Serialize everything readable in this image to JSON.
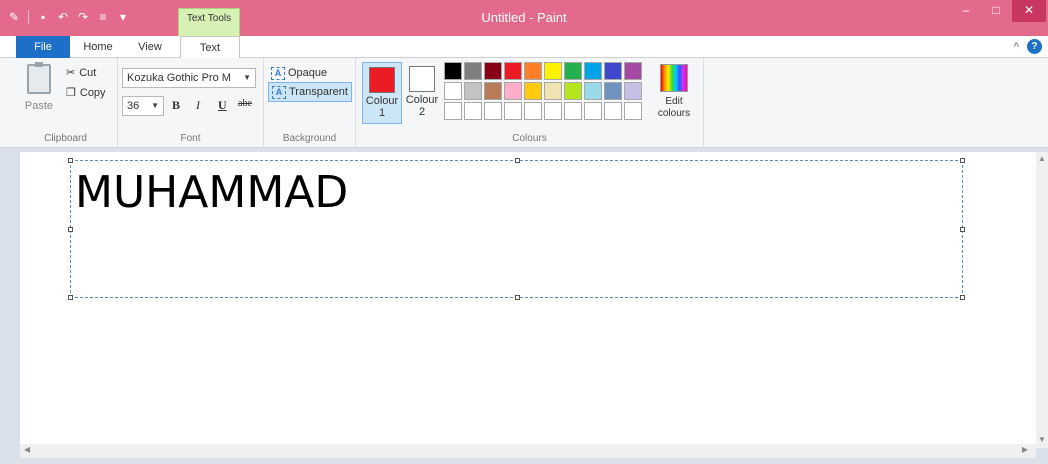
{
  "window": {
    "title": "Untitled - Paint",
    "context_tab": "Text Tools",
    "minimize": "–",
    "maximize": "□",
    "close": "✕"
  },
  "qat": [
    "paint-icon",
    "save-icon",
    "undo-icon",
    "redo-icon",
    "customize-icon"
  ],
  "tabs": {
    "file": "File",
    "home": "Home",
    "view": "View",
    "text": "Text"
  },
  "ribbon": {
    "collapse": "^",
    "help": "?",
    "clipboard": {
      "paste": "Paste",
      "cut": "Cut",
      "copy": "Copy",
      "label": "Clipboard"
    },
    "font": {
      "name": "Kozuka Gothic Pro M",
      "size": "36",
      "bold": "B",
      "italic": "I",
      "underline": "U",
      "strike": "abe",
      "label": "Font"
    },
    "background": {
      "opaque": "Opaque",
      "transparent": "Transparent",
      "label": "Background"
    },
    "colours": {
      "colour1": "Colour 1",
      "colour2": "Colour 2",
      "edit": "Edit colours",
      "label": "Colours",
      "colour1_value": "#ed1c24",
      "colour2_value": "#ffffff",
      "palette_row1": [
        "#000000",
        "#7f7f7f",
        "#880015",
        "#ed1c24",
        "#ff7f27",
        "#fff200",
        "#22b14c",
        "#00a2e8",
        "#3f48cc",
        "#a349a4"
      ],
      "palette_row2": [
        "#ffffff",
        "#c3c3c3",
        "#b97a57",
        "#ffaec9",
        "#ffc90e",
        "#efe4b0",
        "#b5e61d",
        "#99d9ea",
        "#7092be",
        "#c8bfe7"
      ],
      "palette_row3": [
        "#ffffff",
        "#ffffff",
        "#ffffff",
        "#ffffff",
        "#ffffff",
        "#ffffff",
        "#ffffff",
        "#ffffff",
        "#ffffff",
        "#ffffff"
      ]
    }
  },
  "canvas": {
    "text": "MUHAMMAD"
  }
}
